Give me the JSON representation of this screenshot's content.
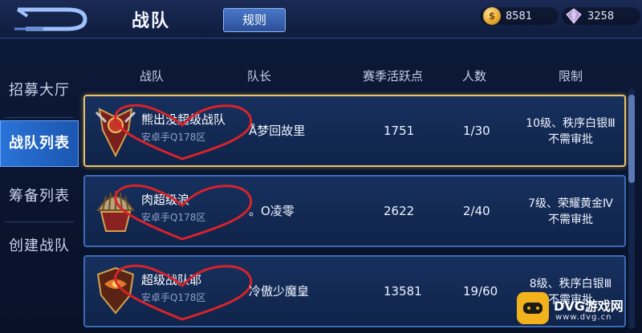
{
  "header": {
    "title": "战队",
    "rules_label": "规则",
    "gold": "8581",
    "gems": "3258"
  },
  "sidebar": {
    "items": [
      {
        "label": "招募大厅",
        "active": false
      },
      {
        "label": "战队列表",
        "active": true
      },
      {
        "label": "筹备列表",
        "active": false
      },
      {
        "label": "创建战队",
        "active": false
      }
    ]
  },
  "table": {
    "headers": {
      "team": "战队",
      "leader": "队长",
      "points": "赛季活跃点",
      "members": "人数",
      "limit": "限制"
    },
    "rows": [
      {
        "name": "熊出没超级战队",
        "sub": "安卓手Q178区",
        "leader": "Å梦回故里",
        "points": "1751",
        "members": "1/30",
        "limit_line1": "10级、秩序白银Ⅲ",
        "limit_line2": "不需审批"
      },
      {
        "name": "肉超级浪",
        "sub": "安卓手Q178区",
        "leader": "。O凌零",
        "points": "2622",
        "members": "2/40",
        "limit_line1": "7级、荣耀黄金Ⅳ",
        "limit_line2": "不需审批"
      },
      {
        "name": "超级战队耶",
        "sub": "安卓手Q178区",
        "leader": "冷傲少魔皇",
        "points": "13581",
        "members": "19/60",
        "limit_line1": "8级、秩序白银Ⅲ",
        "limit_line2": "不需审批"
      }
    ]
  },
  "watermark": {
    "text": "DVG游戏网",
    "url": "www.dvg.cn"
  },
  "colors": {
    "active_tab": "#2a74d8",
    "selected_border": "#e7c46a",
    "heart_annotation": "#d8232a"
  }
}
